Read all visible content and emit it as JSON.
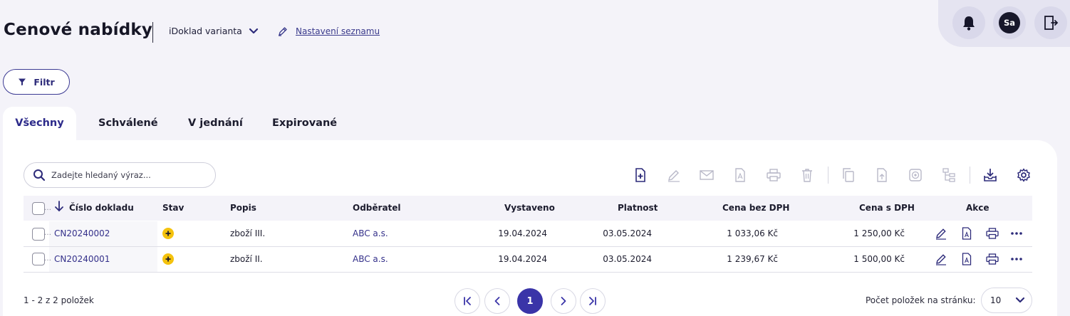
{
  "header": {
    "title": "Cenové nabídky",
    "variant_label": "iDoklad varianta",
    "settings_link": "Nastavení seznamu",
    "avatar_initials": "Sa"
  },
  "filter": {
    "label": "Filtr"
  },
  "tabs": [
    {
      "label": "Všechny",
      "active": true
    },
    {
      "label": "Schválené",
      "active": false
    },
    {
      "label": "V jednání",
      "active": false
    },
    {
      "label": "Expirované",
      "active": false
    }
  ],
  "search": {
    "placeholder": "Zadejte hledaný výraz..."
  },
  "toolbar": {
    "icons": [
      "new-document-icon",
      "edit-icon",
      "email-icon",
      "pdf-icon",
      "print-icon",
      "delete-icon",
      "copy-icon",
      "export-icon",
      "stamp-icon",
      "structure-icon",
      "download-icon",
      "settings-icon"
    ]
  },
  "table": {
    "columns": {
      "number": "Číslo dokladu",
      "status": "Stav",
      "description": "Popis",
      "customer": "Odběratel",
      "issued": "Vystaveno",
      "valid": "Platnost",
      "price_net": "Cena bez DPH",
      "price_gross": "Cena s DPH",
      "actions": "Akce"
    },
    "rows": [
      {
        "number": "CN20240002",
        "status": "pending",
        "description": "zboží III.",
        "customer": "ABC a.s.",
        "issued": "19.04.2024",
        "valid": "03.05.2024",
        "price_net": "1 033,06 Kč",
        "price_gross": "1 250,00 Kč"
      },
      {
        "number": "CN20240001",
        "status": "pending",
        "description": "zboží II.",
        "customer": "ABC a.s.",
        "issued": "19.04.2024",
        "valid": "03.05.2024",
        "price_net": "1 239,67 Kč",
        "price_gross": "1 500,00 Kč"
      }
    ]
  },
  "footer": {
    "range_text": "1 - 2 z 2 položek",
    "current_page": "1",
    "per_page_label": "Počet položek na stránku:",
    "per_page_value": "10"
  },
  "colors": {
    "accent": "#3a34a8",
    "status_pending": "#f4c20d",
    "background": "#f4f3f9"
  }
}
